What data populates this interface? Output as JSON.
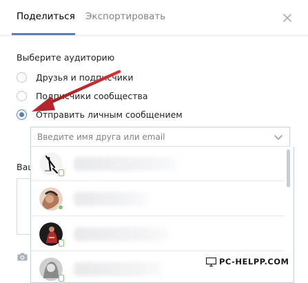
{
  "tabs": [
    {
      "label": "Поделиться",
      "active": true
    },
    {
      "label": "Экспортировать",
      "active": false
    }
  ],
  "audience": {
    "title": "Выберите аудиторию",
    "options": [
      {
        "label": "Друзья и подписчики",
        "checked": false
      },
      {
        "label": "Подписчики сообщества",
        "checked": false
      },
      {
        "label": "Отправить личным сообщением",
        "checked": true
      }
    ]
  },
  "friend_search": {
    "placeholder": "Введите имя друга или email"
  },
  "message": {
    "label": "Ваш"
  },
  "friends_list": [
    {
      "avatar_color": "#dcdcdc",
      "online": "mobile"
    },
    {
      "avatar_color": "#c9a58a",
      "online": "dot"
    },
    {
      "avatar_color": "#5a1f1f",
      "online": "mobile"
    },
    {
      "avatar_color": "#b9b9b9",
      "online": "mobile"
    }
  ],
  "watermark": {
    "text": "PC-HELPP.COM"
  },
  "colors": {
    "accent": "#5181b8",
    "arrow": "#c0272d",
    "online": "#8ac176"
  }
}
